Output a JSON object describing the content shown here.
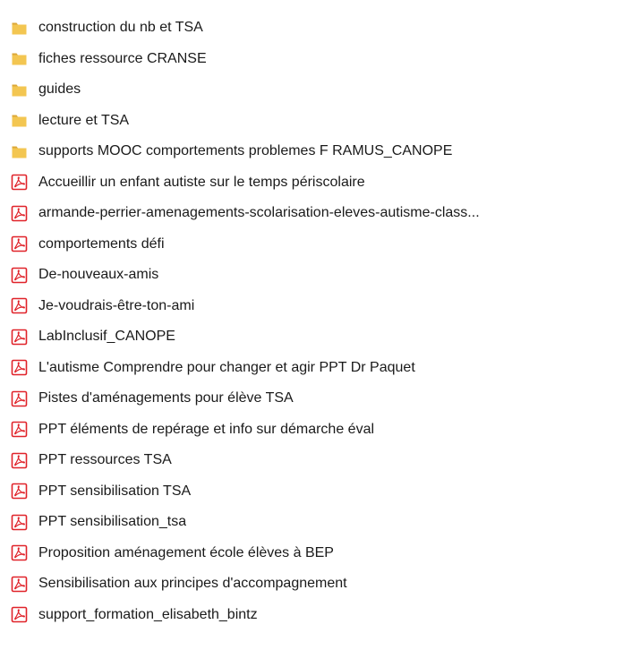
{
  "items": [
    {
      "type": "folder",
      "icon": "folder-icon",
      "name": "construction du nb et TSA"
    },
    {
      "type": "folder",
      "icon": "folder-icon",
      "name": "fiches ressource CRANSE"
    },
    {
      "type": "folder",
      "icon": "folder-icon",
      "name": "guides"
    },
    {
      "type": "folder",
      "icon": "folder-icon",
      "name": "lecture et TSA"
    },
    {
      "type": "folder",
      "icon": "folder-icon",
      "name": "supports MOOC comportements problemes F RAMUS_CANOPE"
    },
    {
      "type": "pdf",
      "icon": "pdf-file-icon",
      "name": "Accueillir un enfant autiste sur le temps périscolaire"
    },
    {
      "type": "pdf",
      "icon": "pdf-file-icon",
      "name": "armande-perrier-amenagements-scolarisation-eleves-autisme-class..."
    },
    {
      "type": "pdf",
      "icon": "pdf-file-icon",
      "name": "comportements défi"
    },
    {
      "type": "pdf",
      "icon": "pdf-file-icon",
      "name": "De-nouveaux-amis"
    },
    {
      "type": "pdf",
      "icon": "pdf-file-icon",
      "name": "Je-voudrais-être-ton-ami"
    },
    {
      "type": "pdf",
      "icon": "pdf-file-icon",
      "name": "LabInclusif_CANOPE"
    },
    {
      "type": "pdf",
      "icon": "pdf-file-icon",
      "name": "L'autisme Comprendre pour changer et agir PPT Dr Paquet"
    },
    {
      "type": "pdf",
      "icon": "pdf-file-icon",
      "name": "Pistes d'aménagements pour élève TSA"
    },
    {
      "type": "pdf",
      "icon": "pdf-file-icon",
      "name": "PPT éléments de repérage et info sur démarche éval"
    },
    {
      "type": "pdf",
      "icon": "pdf-file-icon",
      "name": "PPT ressources TSA"
    },
    {
      "type": "pdf",
      "icon": "pdf-file-icon",
      "name": "PPT sensibilisation TSA"
    },
    {
      "type": "pdf",
      "icon": "pdf-file-icon",
      "name": "PPT sensibilisation_tsa"
    },
    {
      "type": "pdf",
      "icon": "pdf-file-icon",
      "name": "Proposition aménagement école élèves à BEP"
    },
    {
      "type": "pdf",
      "icon": "pdf-file-icon",
      "name": "Sensibilisation aux principes d'accompagnement"
    },
    {
      "type": "pdf",
      "icon": "pdf-file-icon",
      "name": "support_formation_elisabeth_bintz"
    }
  ],
  "colors": {
    "folder": "#f0c04a",
    "folder_dark": "#dca838",
    "pdf_red": "#e0232a",
    "text": "#1a1a1a"
  }
}
